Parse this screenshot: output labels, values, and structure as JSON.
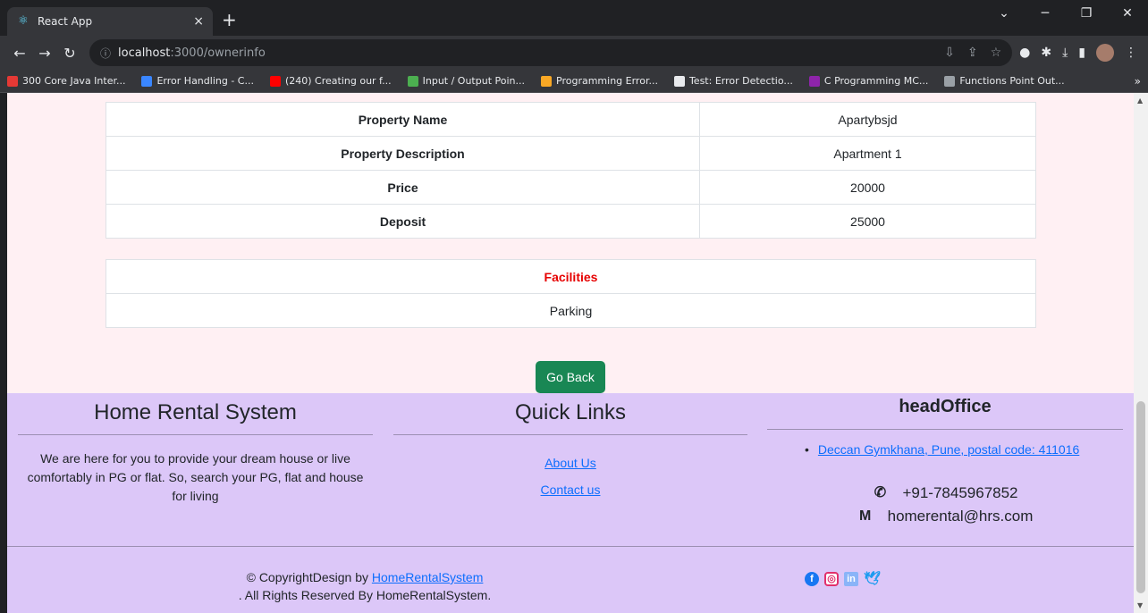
{
  "browser": {
    "tab_title": "React App",
    "tab_close": "×",
    "new_tab": "+",
    "url_host": "localhost",
    "url_path": ":3000/ownerinfo",
    "bookmarks": [
      {
        "label": "300 Core Java Inter...",
        "color": "#e53935"
      },
      {
        "label": "Error Handling - C...",
        "color": "#3a86ff"
      },
      {
        "label": "(240) Creating our f...",
        "color": "#ff0000"
      },
      {
        "label": "Input / Output Poin...",
        "color": "#4caf50"
      },
      {
        "label": "Programming Error...",
        "color": "#f9a825"
      },
      {
        "label": "Test: Error Detectio...",
        "color": "#e8eaed"
      },
      {
        "label": "C Programming MC...",
        "color": "#8e24aa"
      },
      {
        "label": "Functions Point Out...",
        "color": "#9aa0a6"
      }
    ],
    "bookmarks_more": "»"
  },
  "details": [
    {
      "key": "Property Name",
      "value": "Apartybsjd"
    },
    {
      "key": "Property Description",
      "value": "Apartment 1"
    },
    {
      "key": "Price",
      "value": "20000"
    },
    {
      "key": "Deposit",
      "value": "25000"
    }
  ],
  "facilities": {
    "heading": "Facilities",
    "items": [
      "Parking"
    ]
  },
  "go_back_label": "Go Back",
  "footer": {
    "about_title": "Home Rental System",
    "about_text": "We are here for you to provide your dream house or live comfortably in PG or flat. So, search your PG, flat and house for living",
    "quick_links_title": "Quick Links",
    "quick_links": [
      "About Us",
      "Contact us"
    ],
    "office_title": "headOffice",
    "address": "Deccan Gymkhana, Pune, postal code: 411016",
    "phone": "+91-7845967852",
    "email": "homerental@hrs.com",
    "copyright_prefix": "© CopyrightDesign by ",
    "copyright_link": "HomeRentalSystem",
    "rights": ". All Rights Reserved By HomeRentalSystem.",
    "social": [
      "facebook-icon",
      "instagram-icon",
      "linkedin-icon",
      "twitter-icon"
    ]
  }
}
